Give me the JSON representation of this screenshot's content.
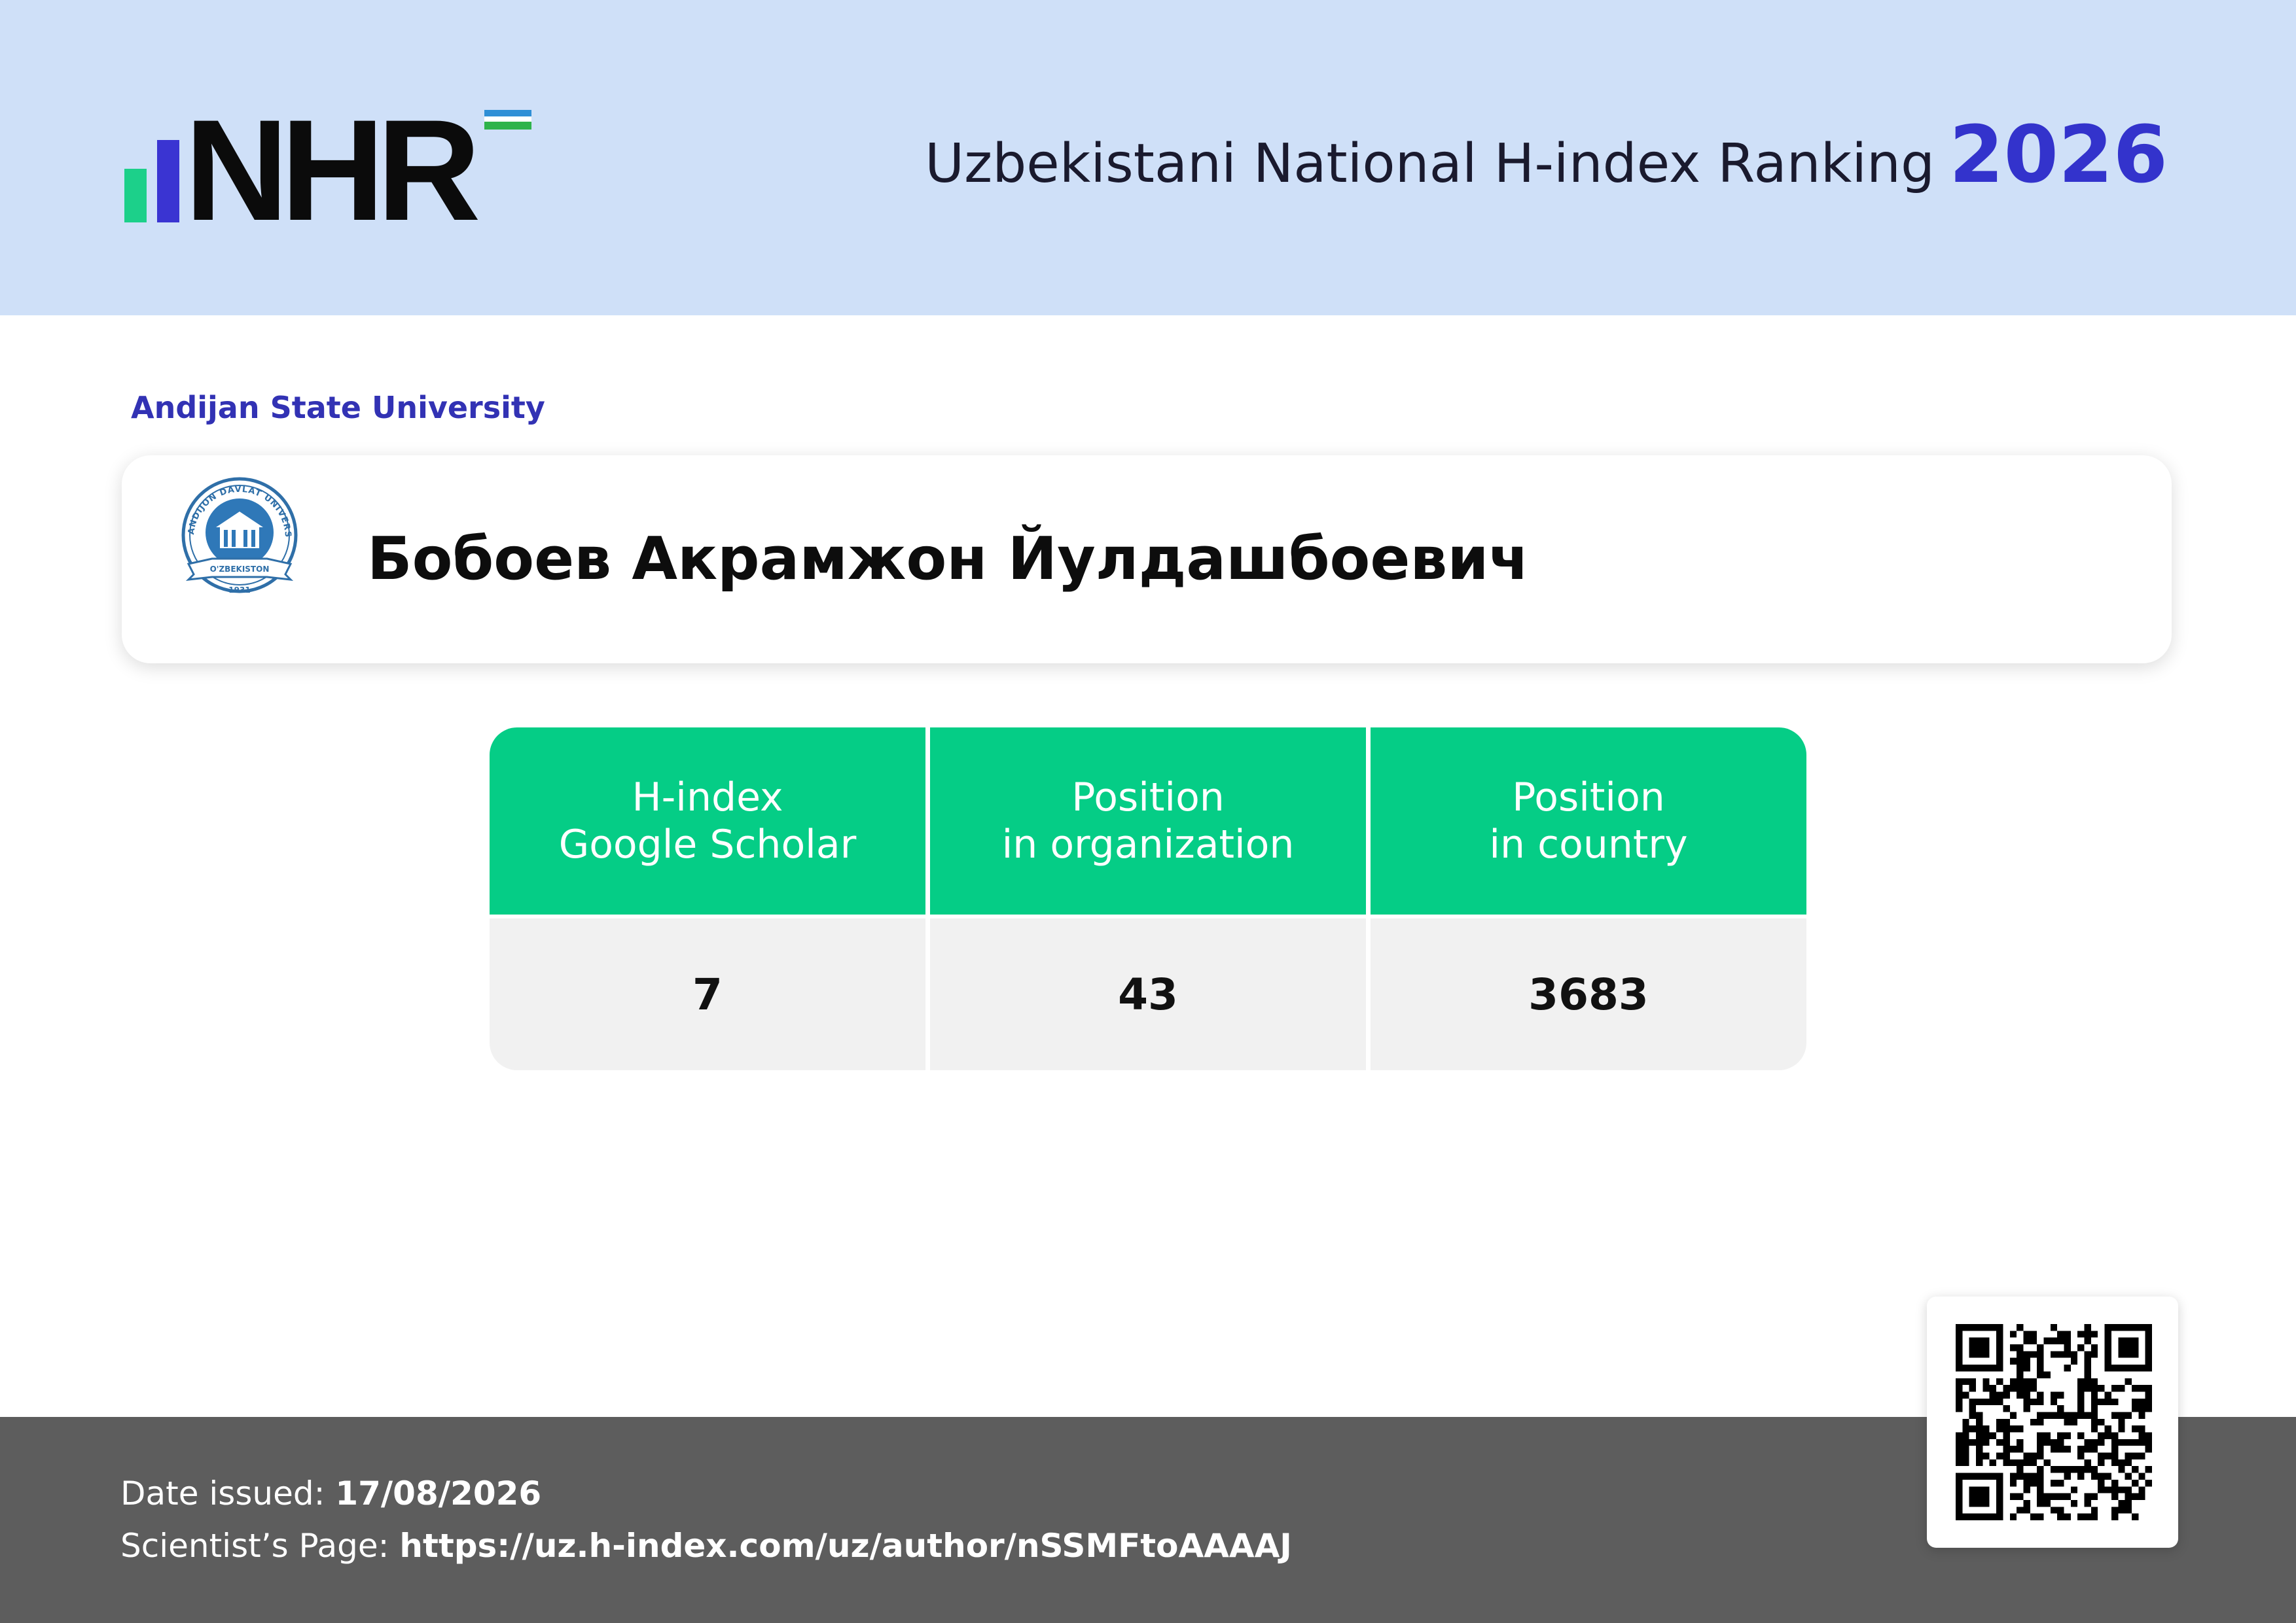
{
  "header": {
    "logo_text": "NHR",
    "title": "Uzbekistani National H-index Ranking",
    "year": "2026"
  },
  "organization": {
    "name": "Andijan State University",
    "seal_text": "ANDIJON DAVLAT UNIVERSITETI",
    "seal_country": "O'ZBEKISTON",
    "seal_year": "1931"
  },
  "scientist": {
    "name": "Бобоев Акрамжон Йулдашбоевич"
  },
  "stats": {
    "columns": [
      {
        "line1": "H-index",
        "line2": "Google Scholar",
        "value": "7"
      },
      {
        "line1": "Position",
        "line2": "in organization",
        "value": "43"
      },
      {
        "line1": "Position",
        "line2": "in country",
        "value": "3683"
      }
    ]
  },
  "footer": {
    "date_label": "Date issued:",
    "date_value": "17/08/2026",
    "page_label": "Scientist’s Page:",
    "page_url": "https://uz.h-index.com/uz/author/nSSMFtoAAAAJ"
  },
  "colors": {
    "header_bg": "#cfe0f8",
    "accent_blue": "#3333cc",
    "accent_green": "#05cd86",
    "footer_bg": "#5d5d5d"
  },
  "icons": {
    "logo": "nhr-logo",
    "seal": "university-seal-icon",
    "qr": "qr-code-icon"
  }
}
